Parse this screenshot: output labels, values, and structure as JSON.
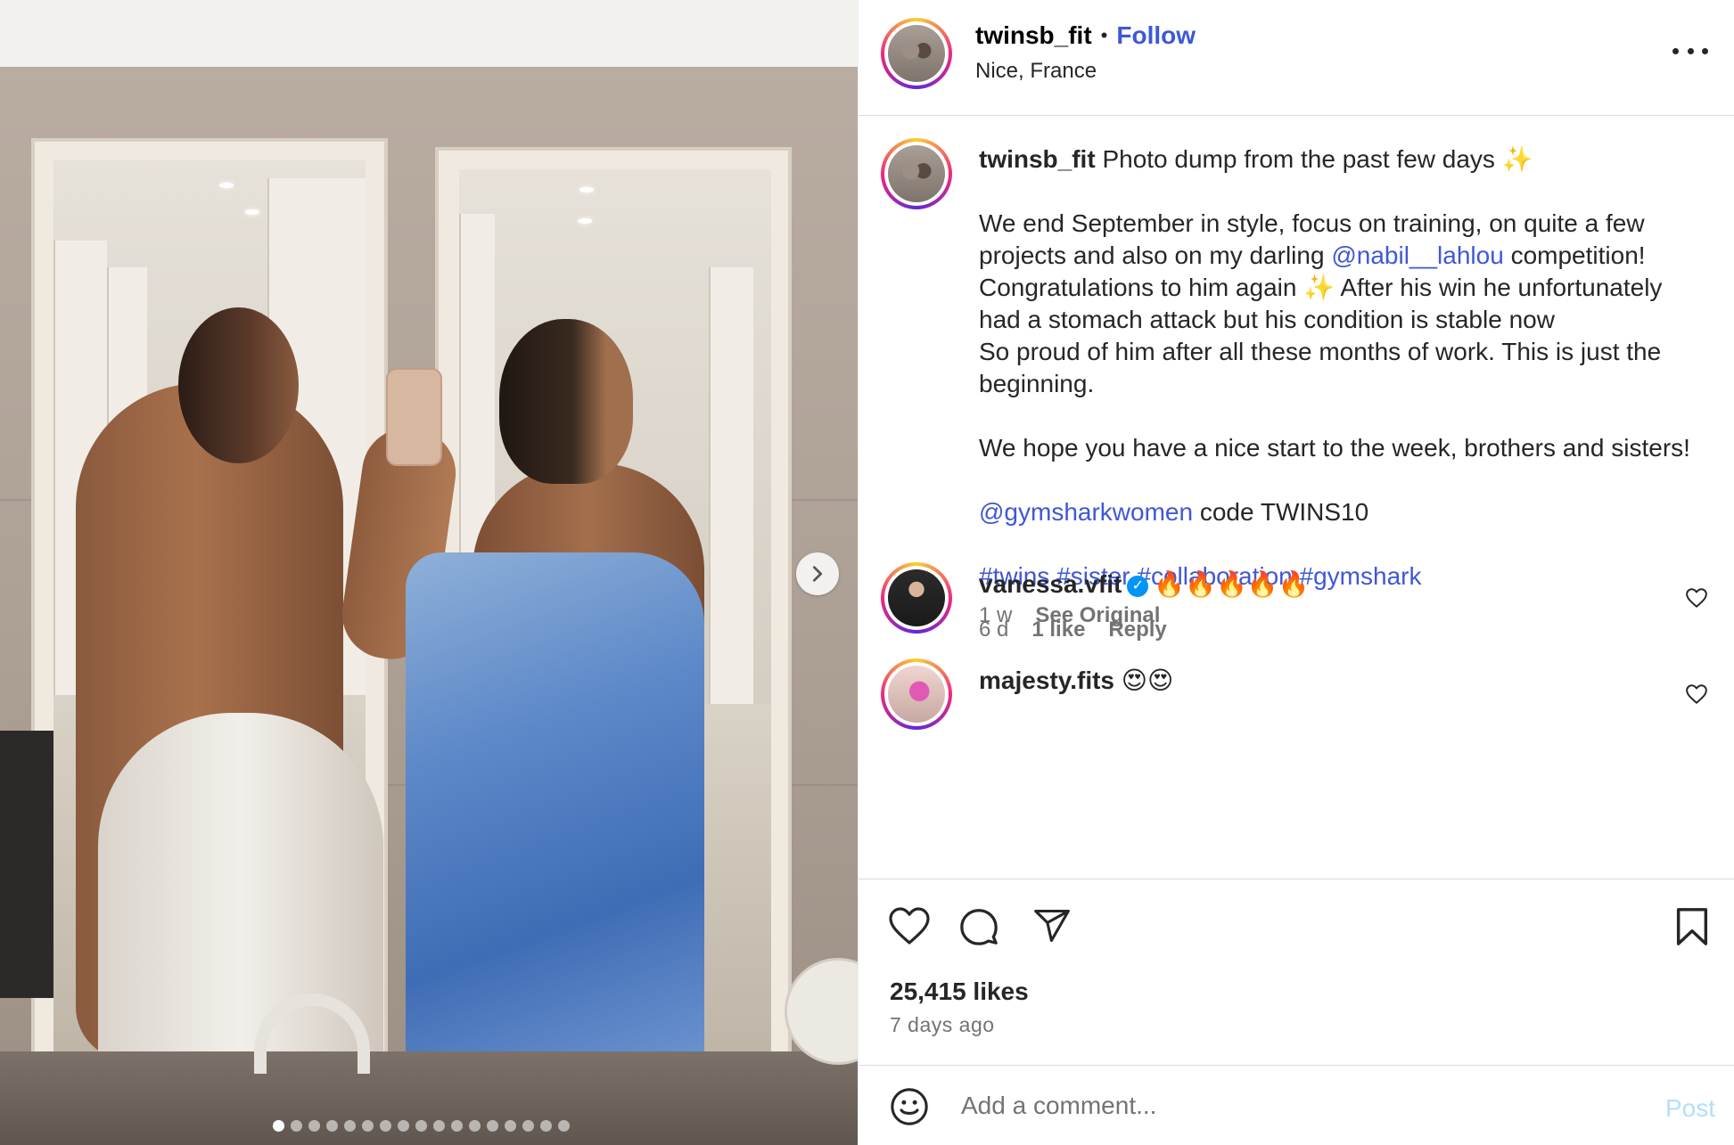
{
  "post": {
    "username": "twinsb_fit",
    "follow_label": "Follow",
    "separator": "•",
    "location": "Nice, France",
    "slide_count": 17,
    "active_slide": 1
  },
  "caption": {
    "username": "twinsb_fit",
    "line1": "Photo dump from the past few days",
    "sparkle": "✨",
    "para2_a": "We end September in style, focus on training, on quite a few projects and also on my darling",
    "para2_mention": "@nabil__lahlou",
    "para2_b": "competition! Congratulations to him again",
    "para2_c": "After his win he unfortunately had a stomach attack but his condition is stable now",
    "para2_d": "So proud of him after all these months of work. This is just the beginning.",
    "para3": "We hope you have a nice start to the week, brothers and sisters!",
    "mention2": "@gymsharkwomen",
    "code_text": "code TWINS10",
    "hashtags": [
      "#twins",
      "#sister",
      "#collaboration",
      "#gymshark"
    ],
    "time": "1 w",
    "see_original": "See Original"
  },
  "comments": [
    {
      "username": "vanessa.vfit",
      "verified": true,
      "text": "🔥🔥🔥🔥🔥",
      "time": "6 d",
      "likes": "1 like",
      "reply": "Reply"
    },
    {
      "username": "majesty.fits",
      "verified": false,
      "text": "😍😍",
      "time": "",
      "likes": "",
      "reply": ""
    }
  ],
  "footer": {
    "likes": "25,415 likes",
    "ago": "7 days ago",
    "add_comment_placeholder": "Add a comment...",
    "post_label": "Post"
  },
  "icons": {
    "more": "more-options-icon",
    "next": "chevron-right-icon",
    "like": "heart-icon",
    "comment": "comment-bubble-icon",
    "share": "paper-plane-icon",
    "save": "bookmark-icon",
    "emoji": "emoji-smile-icon"
  },
  "colors": {
    "link": "#3f58d6",
    "muted": "#737373",
    "post_disabled": "#b2dffc",
    "verified": "#0095f6"
  }
}
